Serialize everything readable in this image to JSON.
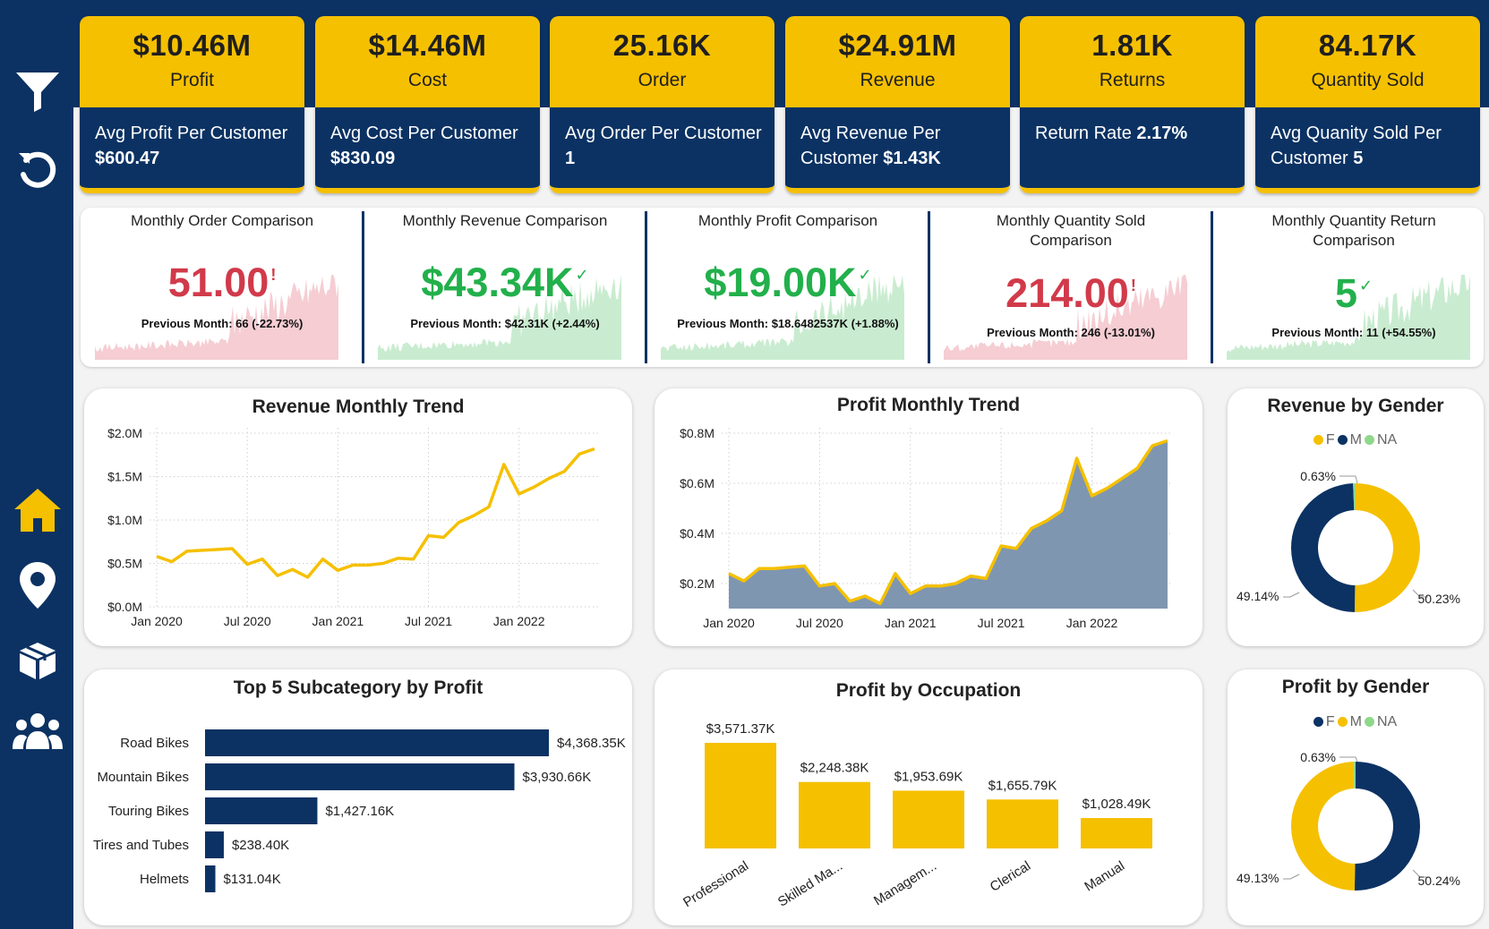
{
  "colors": {
    "navy": "#0b3263",
    "yellow": "#f5c000",
    "green": "#22b04b",
    "red": "#d13a4a",
    "na_green": "#8fd88b",
    "area": "#7f96b1"
  },
  "nav": {
    "icons": [
      "filter-icon",
      "reset-icon",
      "home-icon",
      "map-pin-icon",
      "package-icon",
      "users-icon"
    ]
  },
  "kpis": [
    {
      "value": "$10.46M",
      "label": "Profit",
      "sub_text": "Avg Profit Per Customer",
      "sub_value": "$600.47"
    },
    {
      "value": "$14.46M",
      "label": "Cost",
      "sub_text": "Avg Cost Per Customer",
      "sub_value": "$830.09"
    },
    {
      "value": "25.16K",
      "label": "Order",
      "sub_text": "Avg Order Per Customer",
      "sub_value": "1"
    },
    {
      "value": "$24.91M",
      "label": "Revenue",
      "sub_text": "Avg Revenue Per Customer",
      "sub_value": "$1.43K"
    },
    {
      "value": "1.81K",
      "label": "Returns",
      "sub_text": "Return Rate",
      "sub_value": "2.17%"
    },
    {
      "value": "84.17K",
      "label": "Quantity Sold",
      "sub_text": "Avg Quanity Sold Per Customer",
      "sub_value": "5"
    }
  ],
  "comparisons": [
    {
      "title": "Monthly Order Comparison",
      "value": "51.00",
      "mark": "!",
      "status": "down",
      "previous": "Previous Month: 66 (-22.73%)"
    },
    {
      "title": "Monthly Revenue Comparison",
      "value": "$43.34K",
      "mark": "✓",
      "status": "up",
      "previous": "Previous Month: $42.31K (+2.44%)"
    },
    {
      "title": "Monthly Profit Comparison",
      "value": "$19.00K",
      "mark": "✓",
      "status": "up",
      "previous": "Previous Month: $18.6482537K (+1.88%)"
    },
    {
      "title": "Monthly Quantity Sold Comparison",
      "value": "214.00",
      "mark": "!",
      "status": "down",
      "previous": "Previous Month: 246 (-13.01%)"
    },
    {
      "title": "Monthly Quantity Return Comparison",
      "value": "5",
      "mark": "✓",
      "status": "up",
      "previous": "Previous Month: 11 (+54.55%)"
    }
  ],
  "chart_data": [
    {
      "id": "revenue_trend",
      "type": "line",
      "title": "Revenue Monthly Trend",
      "unit": "M",
      "x": [
        "2020-01",
        "2020-02",
        "2020-03",
        "2020-04",
        "2020-05",
        "2020-06",
        "2020-07",
        "2020-08",
        "2020-09",
        "2020-10",
        "2020-11",
        "2020-12",
        "2021-01",
        "2021-02",
        "2021-03",
        "2021-04",
        "2021-05",
        "2021-06",
        "2021-07",
        "2021-08",
        "2021-09",
        "2021-10",
        "2021-11",
        "2021-12",
        "2022-01",
        "2022-02",
        "2022-03",
        "2022-04",
        "2022-05",
        "2022-06"
      ],
      "values": [
        0.58,
        0.52,
        0.64,
        0.65,
        0.66,
        0.67,
        0.49,
        0.55,
        0.36,
        0.43,
        0.34,
        0.55,
        0.42,
        0.48,
        0.48,
        0.5,
        0.56,
        0.55,
        0.82,
        0.8,
        0.97,
        1.05,
        1.15,
        1.64,
        1.3,
        1.38,
        1.48,
        1.56,
        1.76,
        1.82
      ],
      "x_ticks": [
        "Jan 2020",
        "Jul 2020",
        "Jan 2021",
        "Jul 2021",
        "Jan 2022"
      ],
      "y_ticks": [
        "$0.0M",
        "$0.5M",
        "$1.0M",
        "$1.5M",
        "$2.0M"
      ],
      "ylim": [
        0,
        2.0
      ],
      "grid": true
    },
    {
      "id": "profit_trend",
      "type": "area",
      "title": "Profit Monthly Trend",
      "unit": "M",
      "x": [
        "2020-01",
        "2020-02",
        "2020-03",
        "2020-04",
        "2020-05",
        "2020-06",
        "2020-07",
        "2020-08",
        "2020-09",
        "2020-10",
        "2020-11",
        "2020-12",
        "2021-01",
        "2021-02",
        "2021-03",
        "2021-04",
        "2021-05",
        "2021-06",
        "2021-07",
        "2021-08",
        "2021-09",
        "2021-10",
        "2021-11",
        "2021-12",
        "2022-01",
        "2022-02",
        "2022-03",
        "2022-04",
        "2022-05",
        "2022-06"
      ],
      "values": [
        0.24,
        0.21,
        0.26,
        0.26,
        0.265,
        0.27,
        0.19,
        0.2,
        0.13,
        0.15,
        0.12,
        0.24,
        0.16,
        0.19,
        0.19,
        0.2,
        0.23,
        0.22,
        0.35,
        0.34,
        0.42,
        0.45,
        0.49,
        0.7,
        0.55,
        0.58,
        0.62,
        0.66,
        0.75,
        0.77
      ],
      "x_ticks": [
        "Jan 2020",
        "Jul 2020",
        "Jan 2021",
        "Jul 2021",
        "Jan 2022"
      ],
      "y_ticks": [
        "$0.2M",
        "$0.4M",
        "$0.6M",
        "$0.8M"
      ],
      "ylim": [
        0.1,
        0.8
      ],
      "grid": true
    },
    {
      "id": "revenue_gender",
      "type": "pie",
      "title": "Revenue by Gender",
      "donut": true,
      "legend": [
        {
          "name": "F",
          "color": "#f5c000"
        },
        {
          "name": "M",
          "color": "#0b3263"
        },
        {
          "name": "NA",
          "color": "#8fd88b"
        }
      ],
      "slices": [
        {
          "name": "F",
          "value": 50.23,
          "label": "50.23%",
          "color": "#f5c000"
        },
        {
          "name": "M",
          "value": 49.14,
          "label": "49.14%",
          "color": "#0b3263"
        },
        {
          "name": "NA",
          "value": 0.63,
          "label": "0.63%",
          "color": "#8fd88b"
        }
      ]
    },
    {
      "id": "top_subcategory",
      "type": "bar",
      "orientation": "horizontal",
      "title": "Top 5 Subcategory by Profit",
      "categories": [
        "Road Bikes",
        "Mountain Bikes",
        "Touring Bikes",
        "Tires and Tubes",
        "Helmets"
      ],
      "values": [
        4368.35,
        3930.66,
        1427.16,
        238.4,
        131.04
      ],
      "labels": [
        "$4,368.35K",
        "$3,930.66K",
        "$1,427.16K",
        "$238.40K",
        "$131.04K"
      ],
      "unit": "K"
    },
    {
      "id": "profit_occupation",
      "type": "bar",
      "title": "Profit by Occupation",
      "categories": [
        "Professional",
        "Skilled Ma...",
        "Managem...",
        "Clerical",
        "Manual"
      ],
      "values": [
        3571.37,
        2248.38,
        1953.69,
        1655.79,
        1028.49
      ],
      "labels": [
        "$3,571.37K",
        "$2,248.38K",
        "$1,953.69K",
        "$1,655.79K",
        "$1,028.49K"
      ],
      "unit": "K"
    },
    {
      "id": "profit_gender",
      "type": "pie",
      "title": "Profit by Gender",
      "donut": true,
      "legend": [
        {
          "name": "F",
          "color": "#0b3263"
        },
        {
          "name": "M",
          "color": "#f5c000"
        },
        {
          "name": "NA",
          "color": "#8fd88b"
        }
      ],
      "slices": [
        {
          "name": "F",
          "value": 50.24,
          "label": "50.24%",
          "color": "#0b3263"
        },
        {
          "name": "M",
          "value": 49.13,
          "label": "49.13%",
          "color": "#f5c000"
        },
        {
          "name": "NA",
          "value": 0.63,
          "label": "0.63%",
          "color": "#8fd88b"
        }
      ]
    }
  ]
}
